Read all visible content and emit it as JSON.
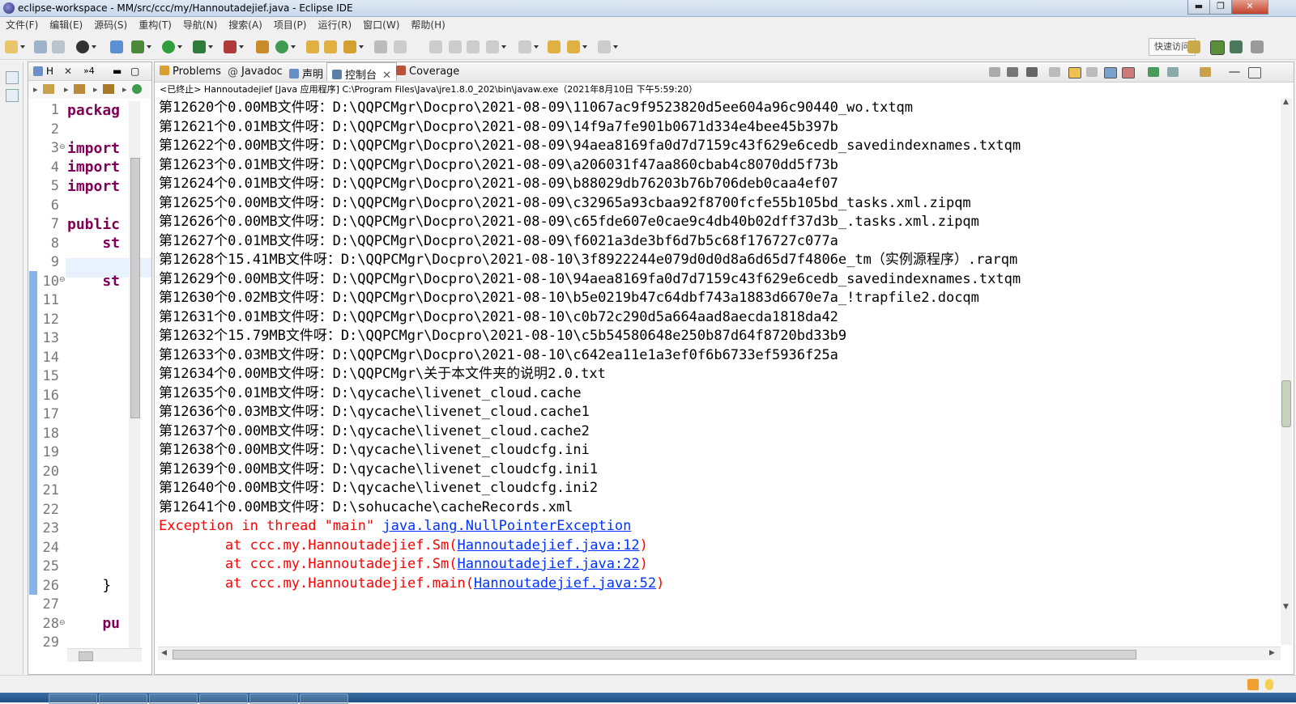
{
  "window": {
    "title": "eclipse-workspace - MM/src/ccc/my/Hannoutadejief.java - Eclipse IDE",
    "minimize_glyph": "▬",
    "restore_glyph": "❐",
    "close_glyph": "✕"
  },
  "menu": [
    "文件(F)",
    "编辑(E)",
    "源码(S)",
    "重构(T)",
    "导航(N)",
    "搜索(A)",
    "项目(P)",
    "运行(R)",
    "窗口(W)",
    "帮助(H)"
  ],
  "toolbar": {
    "quick_access": "快速访问"
  },
  "editor": {
    "tab_label": "H",
    "tab_badge": "»4",
    "line_numbers": [
      "1",
      "2",
      "3",
      "4",
      "5",
      "6",
      "7",
      "8",
      "9",
      "10",
      "11",
      "12",
      "13",
      "14",
      "15",
      "16",
      "17",
      "18",
      "19",
      "20",
      "21",
      "22",
      "23",
      "24",
      "25",
      "26",
      "27",
      "28",
      "29"
    ],
    "code_lines": {
      "l1": "packag",
      "l3": "import",
      "l4": "import",
      "l5": "import",
      "l7": "public",
      "l8": "    st",
      "l10": "    st",
      "l26": "    }",
      "l28": "    pu"
    }
  },
  "console": {
    "tabs": [
      {
        "label": "Problems",
        "icon": "problems-icon"
      },
      {
        "label": "Javadoc",
        "icon": "javadoc-icon"
      },
      {
        "label": "声明",
        "icon": "declaration-icon"
      },
      {
        "label": "控制台",
        "icon": "console-icon",
        "active": true
      },
      {
        "label": "Coverage",
        "icon": "coverage-icon"
      }
    ],
    "header": "<已终止> Hannoutadejief [Java 应用程序] C:\\Program Files\\Java\\jre1.8.0_202\\bin\\javaw.exe（2021年8月10日 下午5:59:20）",
    "output_lines": [
      "第12620个0.00MB文件呀：D:\\QQPCMgr\\Docpro\\2021-08-09\\11067ac9f9523820d5ee604a96c90440_wo.txtqm",
      "第12621个0.01MB文件呀：D:\\QQPCMgr\\Docpro\\2021-08-09\\14f9a7fe901b0671d334e4bee45b397b",
      "第12622个0.00MB文件呀：D:\\QQPCMgr\\Docpro\\2021-08-09\\94aea8169fa0d7d7159c43f629e6cedb_savedindexnames.txtqm",
      "第12623个0.01MB文件呀：D:\\QQPCMgr\\Docpro\\2021-08-09\\a206031f47aa860cbab4c8070dd5f73b",
      "第12624个0.01MB文件呀：D:\\QQPCMgr\\Docpro\\2021-08-09\\b88029db76203b76b706deb0caa4ef07",
      "第12625个0.00MB文件呀：D:\\QQPCMgr\\Docpro\\2021-08-09\\c32965a93cbaa92f8700fcfe55b105bd_tasks.xml.zipqm",
      "第12626个0.00MB文件呀：D:\\QQPCMgr\\Docpro\\2021-08-09\\c65fde607e0cae9c4db40b02dff37d3b_.tasks.xml.zipqm",
      "第12627个0.01MB文件呀：D:\\QQPCMgr\\Docpro\\2021-08-09\\f6021a3de3bf6d7b5c68f176727c077a",
      "第12628个15.41MB文件呀：D:\\QQPCMgr\\Docpro\\2021-08-10\\3f8922244e079d0d0d8a6d65d7f4806e_tm（实例源程序）.rarqm",
      "第12629个0.00MB文件呀：D:\\QQPCMgr\\Docpro\\2021-08-10\\94aea8169fa0d7d7159c43f629e6cedb_savedindexnames.txtqm",
      "第12630个0.02MB文件呀：D:\\QQPCMgr\\Docpro\\2021-08-10\\b5e0219b47c64dbf743a1883d6670e7a_!trapfile2.docqm",
      "第12631个0.01MB文件呀：D:\\QQPCMgr\\Docpro\\2021-08-10\\c0b72c290d5a664aad8aecda1818da42",
      "第12632个15.79MB文件呀：D:\\QQPCMgr\\Docpro\\2021-08-10\\c5b54580648e250b87d64f8720bd33b9",
      "第12633个0.03MB文件呀：D:\\QQPCMgr\\Docpro\\2021-08-10\\c642ea11e1a3ef0f6b6733ef5936f25a",
      "第12634个0.00MB文件呀：D:\\QQPCMgr\\关于本文件夹的说明2.0.txt",
      "第12635个0.01MB文件呀：D:\\qycache\\livenet_cloud.cache",
      "第12636个0.03MB文件呀：D:\\qycache\\livenet_cloud.cache1",
      "第12637个0.00MB文件呀：D:\\qycache\\livenet_cloud.cache2",
      "第12638个0.00MB文件呀：D:\\qycache\\livenet_cloudcfg.ini",
      "第12639个0.00MB文件呀：D:\\qycache\\livenet_cloudcfg.ini1",
      "第12640个0.00MB文件呀：D:\\qycache\\livenet_cloudcfg.ini2",
      "第12641个0.00MB文件呀：D:\\sohucache\\cacheRecords.xml"
    ],
    "exception": {
      "prefix": "Exception in thread \"main\" ",
      "type": "java.lang.NullPointerException",
      "frames": [
        {
          "at": "        at ccc.my.Hannoutadejief.Sm(",
          "loc": "Hannoutadejief.java:12",
          "close": ")"
        },
        {
          "at": "        at ccc.my.Hannoutadejief.Sm(",
          "loc": "Hannoutadejief.java:22",
          "close": ")"
        },
        {
          "at": "        at ccc.my.Hannoutadejief.main(",
          "loc": "Hannoutadejief.java:52",
          "close": ")"
        }
      ]
    }
  },
  "colors": {
    "keyword": "#7f0055",
    "error": "#ff0000",
    "link": "#0033ff"
  }
}
